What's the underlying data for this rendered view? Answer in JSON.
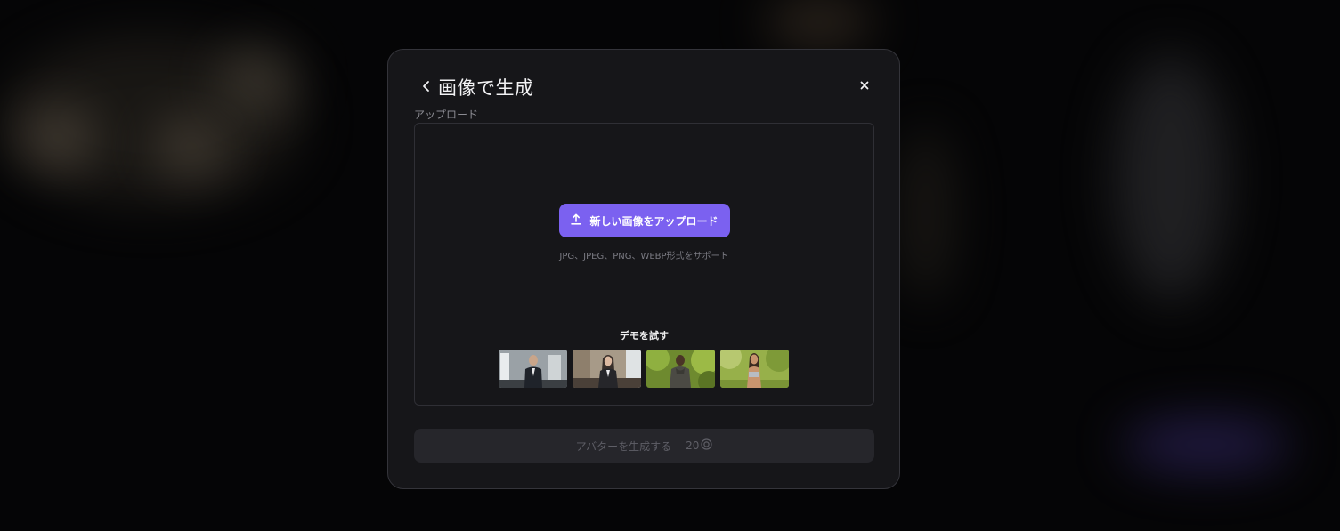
{
  "modal": {
    "title": "画像で生成",
    "upload_label": "アップロード",
    "upload_button_label": "新しい画像をアップロード",
    "formats_text": "JPG、JPEG、PNG、WEBP形式をサポート",
    "demo_title": "デモを試す",
    "demo_images": [
      {
        "name": "businessman-office"
      },
      {
        "name": "businesswoman-office"
      },
      {
        "name": "man-forest"
      },
      {
        "name": "woman-park"
      }
    ],
    "generate_button_label": "アバターを生成する",
    "generate_cost": "20"
  },
  "icons": {
    "back": "chevron-left-icon",
    "close": "close-icon",
    "upload": "upload-arrow-icon",
    "credit": "credit-coin-icon"
  },
  "colors": {
    "accent": "#7b61f0",
    "modal_bg": "#161619",
    "disabled_button": "#26262b"
  }
}
